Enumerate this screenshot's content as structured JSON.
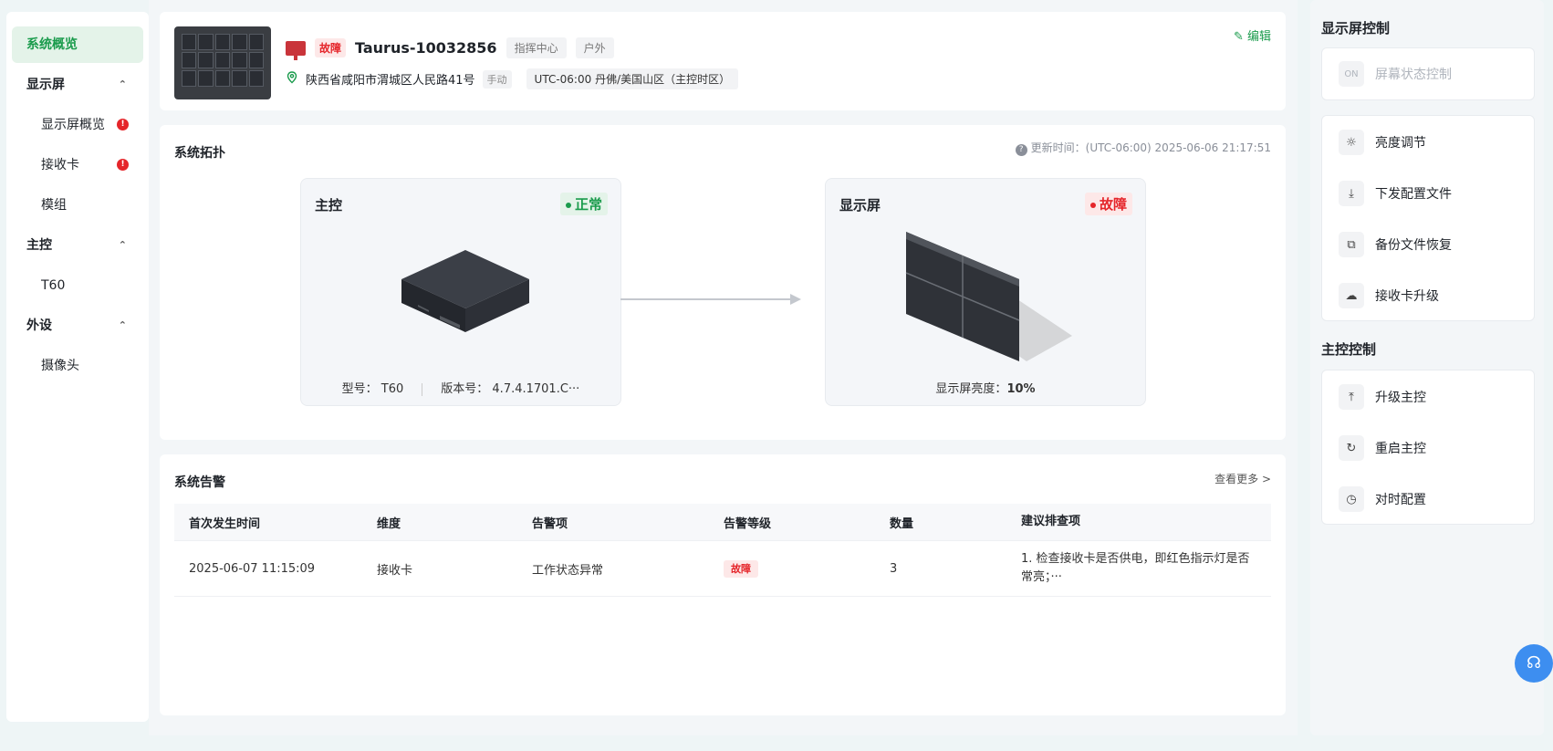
{
  "sidebar": {
    "items": [
      {
        "label": "系统概览"
      },
      {
        "label": "显示屏"
      },
      {
        "label": "显示屏概览"
      },
      {
        "label": "接收卡"
      },
      {
        "label": "模组"
      },
      {
        "label": "主控"
      },
      {
        "label": "T60"
      },
      {
        "label": "外设"
      },
      {
        "label": "摄像头"
      }
    ]
  },
  "header": {
    "status": "故障",
    "device_name": "Taurus-10032856",
    "tags": [
      "指挥中心",
      "户外"
    ],
    "address": "陕西省咸阳市渭城区人民路41号",
    "address_mode": "手动",
    "timezone": "UTC-06:00 丹佛/美国山区（主控时区）",
    "edit_label": "编辑"
  },
  "topology": {
    "title": "系统拓扑",
    "update_time": "更新时间：(UTC-06:00) 2025-06-06 21:17:51",
    "controller": {
      "title": "主控",
      "status": "正常",
      "model": "型号： T60",
      "version": "版本号： 4.7.4.1701.C···"
    },
    "display": {
      "title": "显示屏",
      "status": "故障",
      "brightness_label": "显示屏亮度：",
      "brightness_value": "10%"
    }
  },
  "alerts": {
    "title": "系统告警",
    "more": "查看更多",
    "columns": [
      "首次发生时间",
      "维度",
      "告警项",
      "告警等级",
      "数量",
      "建议排查项"
    ],
    "rows": [
      {
        "time": "2025-06-07 11:15:09",
        "dimension": "接收卡",
        "item": "工作状态异常",
        "level": "故障",
        "count": "3",
        "suggestion": "1. 检查接收卡是否供电，即红色指示灯是否常亮；···"
      }
    ]
  },
  "right_panel": {
    "screen_control_title": "显示屏控制",
    "screen_state": {
      "icon_text": "ON",
      "label": "屏幕状态控制"
    },
    "screen_items": [
      {
        "label": "亮度调节"
      },
      {
        "label": "下发配置文件"
      },
      {
        "label": "备份文件恢复"
      },
      {
        "label": "接收卡升级"
      }
    ],
    "controller_title": "主控控制",
    "controller_items": [
      {
        "label": "升级主控"
      },
      {
        "label": "重启主控"
      },
      {
        "label": "对时配置"
      }
    ]
  },
  "colors": {
    "accent": "#1a9b4c",
    "error": "#e5252a",
    "support": "#3d8ef0"
  }
}
